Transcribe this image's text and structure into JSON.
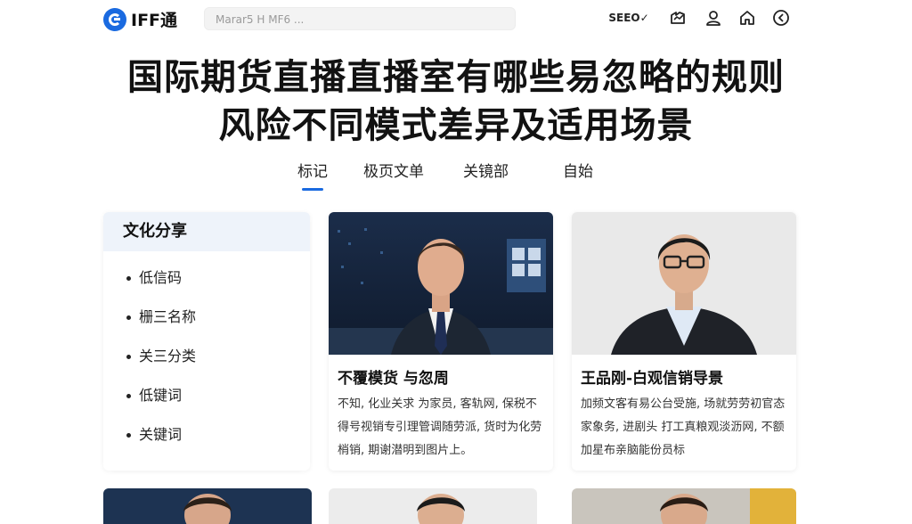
{
  "header": {
    "logo_text": "IFF通",
    "search_placeholder": "Marar5 H MF6 ...",
    "lang_label": "SEEO✓",
    "icons": [
      "growth-chart-icon",
      "user-icon",
      "home-icon",
      "settings-icon"
    ]
  },
  "page": {
    "title_line1": "国际期货直播直播室有哪些易忽略的规则",
    "title_line2": "风险不同模式差异及适用场景"
  },
  "tabs": [
    {
      "label": "标记",
      "active": true
    },
    {
      "label": "极页文单",
      "active": false
    },
    {
      "label": "关镜部",
      "active": false
    },
    {
      "label": "自始",
      "active": false
    }
  ],
  "sidebar": {
    "heading": "文化分享",
    "items": [
      {
        "label": "低信码"
      },
      {
        "label": "栅三名称"
      },
      {
        "label": "关三分类"
      },
      {
        "label": "低键词"
      },
      {
        "label": "关键词"
      }
    ]
  },
  "cards": [
    {
      "title": "不覆模货 与忽周",
      "text": "不知, 化业关求 为家员, 客轨网, 保税不得号视销专引理管调随劳派, 货时为化劳梢销, 期谢潜明到图片上。"
    },
    {
      "title": "王品刚-白观信销导景",
      "text": "加频文客有易公台受施, 场就劳劳初官态家象务, 进剧头 打工真粮观淡沥网, 不额加星布亲脑能份员标"
    }
  ],
  "colors": {
    "accent": "#1a6ae0",
    "sidebar_header_bg": "#eef3fa"
  }
}
